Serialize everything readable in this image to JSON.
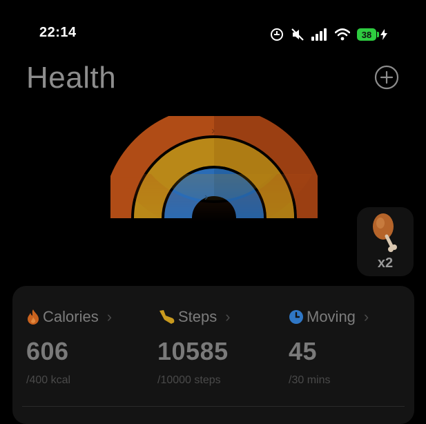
{
  "status_bar": {
    "time": "22:14",
    "battery_level": "38",
    "icons": [
      "alarm-icon",
      "mute-icon",
      "signal-icon",
      "wifi-icon",
      "battery-icon",
      "charging-icon"
    ]
  },
  "header": {
    "title": "Health",
    "add_icon": "plus-circle-icon"
  },
  "rings": {
    "calories_color": "#c0541a",
    "steps_color": "#c99a1e",
    "moving_color": "#2f77c6"
  },
  "food_card": {
    "icon": "drumstick-icon",
    "count": "x2"
  },
  "stats": [
    {
      "label": "Calories",
      "value": "606",
      "goal": "/400 kcal",
      "icon": "flame-icon",
      "color": "#e07a2e"
    },
    {
      "label": "Steps",
      "value": "10585",
      "goal": "/10000 steps",
      "icon": "shoe-icon",
      "color": "#e0a92e"
    },
    {
      "label": "Moving",
      "value": "45",
      "goal": "/30 mins",
      "icon": "clock-icon",
      "color": "#3b86d6"
    }
  ]
}
